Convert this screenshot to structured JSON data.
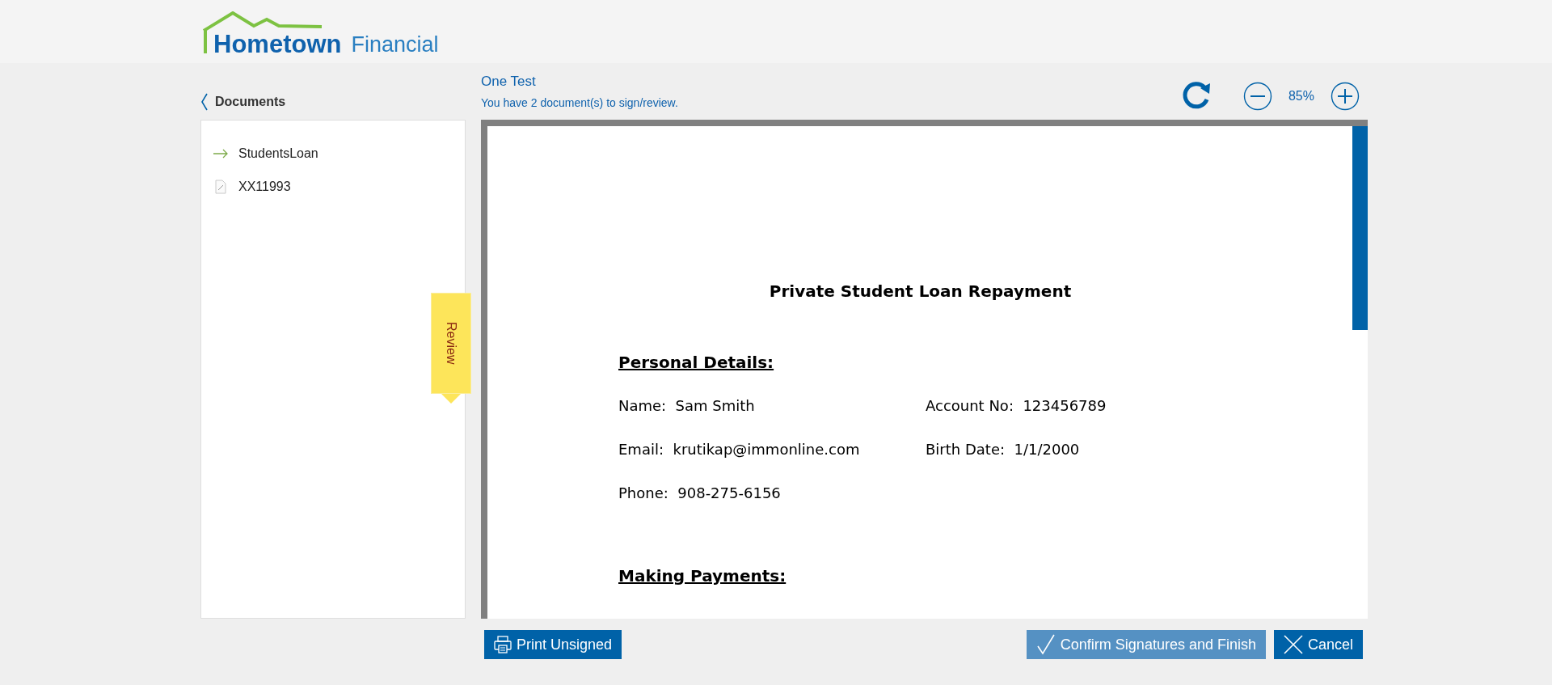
{
  "logo": {
    "brand": "Hometown",
    "suffix": "Financial"
  },
  "sidebar": {
    "back_label": "Documents",
    "items": [
      {
        "label": "StudentsLoan",
        "current": true
      },
      {
        "label": "XX11993",
        "current": false
      }
    ]
  },
  "review_tab": {
    "label": "Review"
  },
  "header": {
    "title": "One Test",
    "subtitle": "You have 2 document(s) to sign/review."
  },
  "zoom": {
    "value": "85%"
  },
  "document": {
    "title": "Private Student Loan Repayment",
    "sections": [
      {
        "heading": "Personal Details:",
        "rows": [
          [
            {
              "label": "Name:",
              "value": "Sam Smith"
            },
            {
              "label": "Account No:",
              "value": "123456789"
            }
          ],
          [
            {
              "label": "Email:",
              "value": "krutikap@immonline.com"
            },
            {
              "label": "Birth Date:",
              "value": "1/1/2000"
            }
          ],
          [
            {
              "label": "Phone:",
              "value": "908-275-6156"
            }
          ]
        ]
      },
      {
        "heading": "Making Payments:"
      }
    ]
  },
  "buttons": [
    {
      "kind": "print",
      "label": "Print Unsigned",
      "disabled": false
    },
    {
      "kind": "confirm",
      "label": "Confirm Signatures and Finish",
      "disabled": true
    },
    {
      "kind": "cancel",
      "label": "Cancel",
      "disabled": false
    }
  ]
}
